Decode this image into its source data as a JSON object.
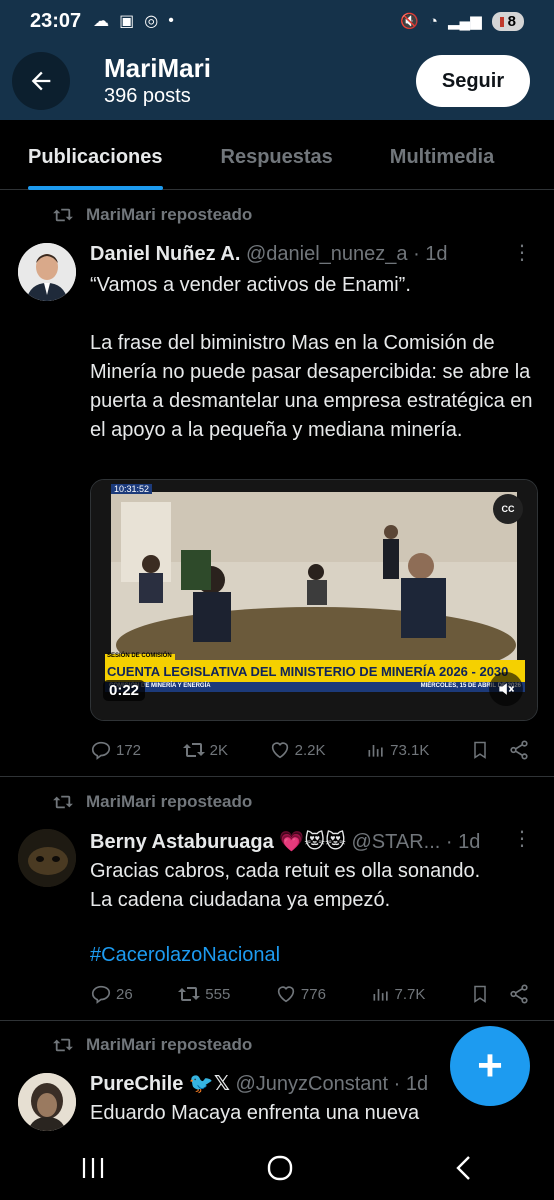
{
  "status": {
    "time": "23:07",
    "battery": "8"
  },
  "header": {
    "name": "MariMari",
    "posts": "396 posts",
    "follow_label": "Seguir"
  },
  "tabs": [
    {
      "label": "Publicaciones",
      "active": true
    },
    {
      "label": "Respuestas",
      "active": false
    },
    {
      "label": "Multimedia",
      "active": false
    }
  ],
  "posts": [
    {
      "repost_label": "MariMari reposteado",
      "name": "Daniel Nuñez A.",
      "handle": "@daniel_nunez_a",
      "time": "· 1d",
      "text": "“Vamos a vender activos de Enami”.\n\nLa frase del biministro Mas en la Comisión de Minería no puede pasar desapercibida: se abre la puerta a desmantelar una empresa estratégica en el apoyo a la pequeña y mediana minería.",
      "video": {
        "timestamp": "10:31:52",
        "banner_small": "SESIÓN DE COMISIÓN",
        "banner": "CUENTA LEGISLATIVA DEL MINISTERIO DE MINERÍA 2026 - 2030",
        "footer_left": "COMISIÓN DE MINERÍA Y ENERGÍA",
        "footer_right": "MIÉRCOLES, 15 DE ABRIL DE 2026",
        "duration": "0:22",
        "cc": "CC"
      },
      "replies": "172",
      "reposts": "2K",
      "likes": "2.2K",
      "views": "73.1K"
    },
    {
      "repost_label": "MariMari reposteado",
      "name": "Berny Astaburuaga 💗😻😻",
      "handle": "@STAR...",
      "time": "· 1d",
      "text": "Gracias cabros, cada retuit es olla sonando.\nLa cadena ciudadana ya empezó.",
      "hashtag": "#CacerolazoNacional",
      "replies": "26",
      "reposts": "555",
      "likes": "776",
      "views": "7.7K"
    },
    {
      "repost_label": "MariMari reposteado",
      "name": "PureChile 🐦𝕏",
      "handle": "@JunyzConstant",
      "time": "· 1d",
      "text": "Eduardo Macaya enfrenta una nueva"
    }
  ],
  "colors": {
    "accent": "#1d9bf0",
    "header_bg": "#15324a",
    "muted": "#71767b"
  }
}
